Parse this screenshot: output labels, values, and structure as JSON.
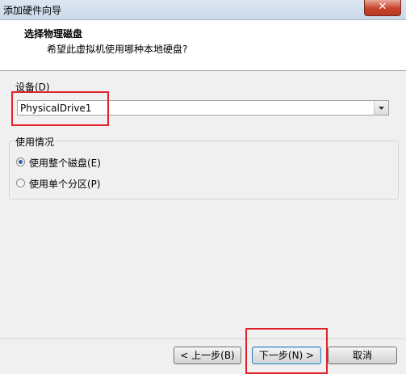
{
  "window": {
    "title": "添加硬件向导",
    "close_label": "✕"
  },
  "header": {
    "title": "选择物理磁盘",
    "subtitle": "希望此虚拟机使用哪种本地硬盘?"
  },
  "device": {
    "label": "设备(D)",
    "selected": "PhysicalDrive1"
  },
  "usage": {
    "label": "使用情况",
    "options": [
      {
        "label": "使用整个磁盘(E)",
        "checked": true
      },
      {
        "label": "使用单个分区(P)",
        "checked": false
      }
    ]
  },
  "buttons": {
    "back": "< 上一步(B)",
    "next": "下一步(N) >",
    "cancel": "取消"
  },
  "colors": {
    "highlight": "#e0232b",
    "radio_checked": "#2f5fa8"
  }
}
